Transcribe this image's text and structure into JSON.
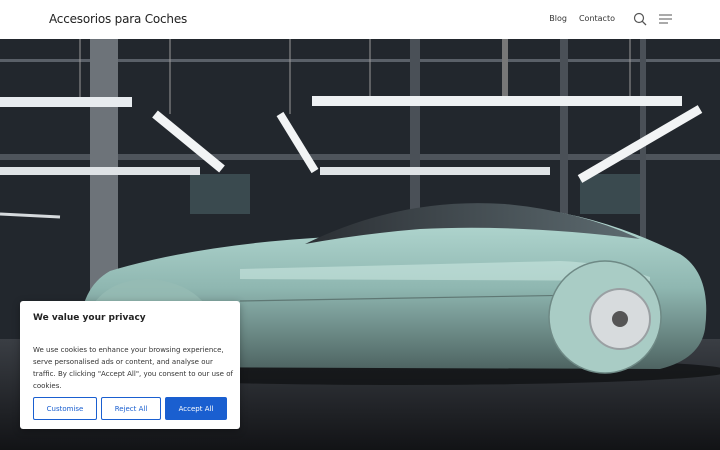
{
  "header": {
    "brand": "Accesorios para Coches",
    "nav": [
      {
        "label": "Blog"
      },
      {
        "label": "Contacto"
      }
    ],
    "icons": [
      "search-icon",
      "menu-icon"
    ]
  },
  "hero": {
    "image": "concept-car-in-industrial-hall"
  },
  "cookie_banner": {
    "title": "We value your privacy",
    "text": "We use cookies to enhance your browsing experience, serve personalised ads or content, and analyse our traffic. By clicking \"Accept All\", you consent to our use of cookies.",
    "customise_label": "Customise",
    "reject_label": "Reject All",
    "accept_label": "Accept All",
    "accent_color": "#1a5fd0"
  }
}
